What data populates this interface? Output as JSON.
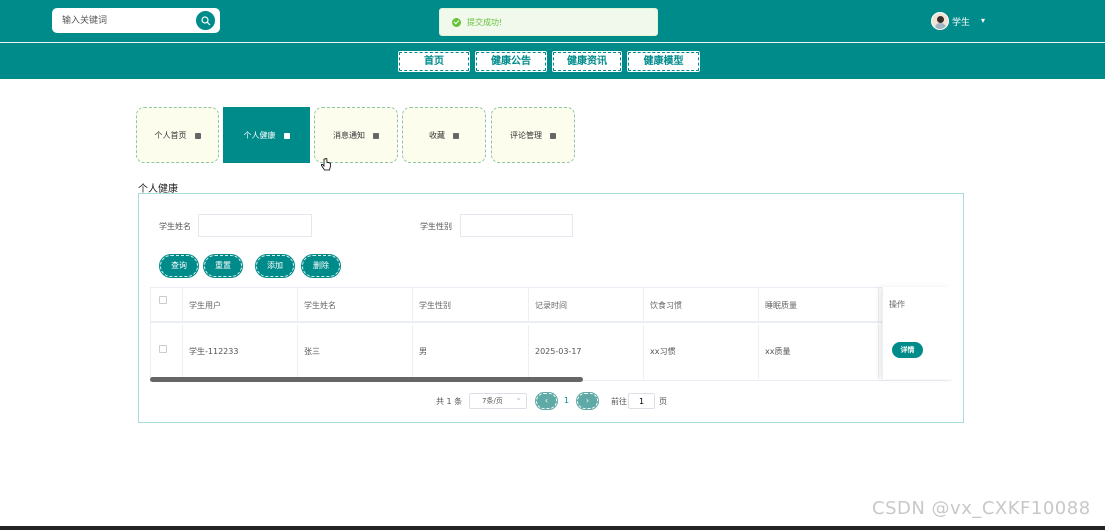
{
  "header": {
    "search": {
      "placeholder": "输入关键词"
    },
    "toast": "提交成功!",
    "user": {
      "name": "学生"
    },
    "nav": [
      "首页",
      "健康公告",
      "健康资讯",
      "健康模型"
    ]
  },
  "tabs": [
    {
      "label": "个人首页",
      "active": false
    },
    {
      "label": "个人健康",
      "active": true
    },
    {
      "label": "消息通知",
      "active": false
    },
    {
      "label": "收藏",
      "active": false
    },
    {
      "label": "评论管理",
      "active": false
    }
  ],
  "section_title": "个人健康",
  "filters": {
    "name_label": "学生姓名",
    "gender_label": "学生性别"
  },
  "buttons": {
    "query": "查询",
    "reset": "重置",
    "add": "添加",
    "delete": "删除"
  },
  "table": {
    "headers": [
      "学生用户",
      "学生姓名",
      "学生性别",
      "记录时间",
      "饮食习惯",
      "睡眠质量"
    ],
    "op_header": "操作",
    "rows": [
      {
        "cells": [
          "学生-112233",
          "张三",
          "男",
          "2025-03-17",
          "xx习惯",
          "xx质量"
        ],
        "action": "详情"
      }
    ]
  },
  "pagination": {
    "total": "共 1 条",
    "page_size": "7条/页",
    "current_page": "1",
    "goto_label": "前往",
    "goto_value": "1",
    "page_suffix": "页"
  },
  "watermark": "CSDN @vx_CXKF10088",
  "colors": {
    "primary": "#008b8b",
    "tab_bg": "#fdfdee",
    "success": "#67c23a"
  }
}
